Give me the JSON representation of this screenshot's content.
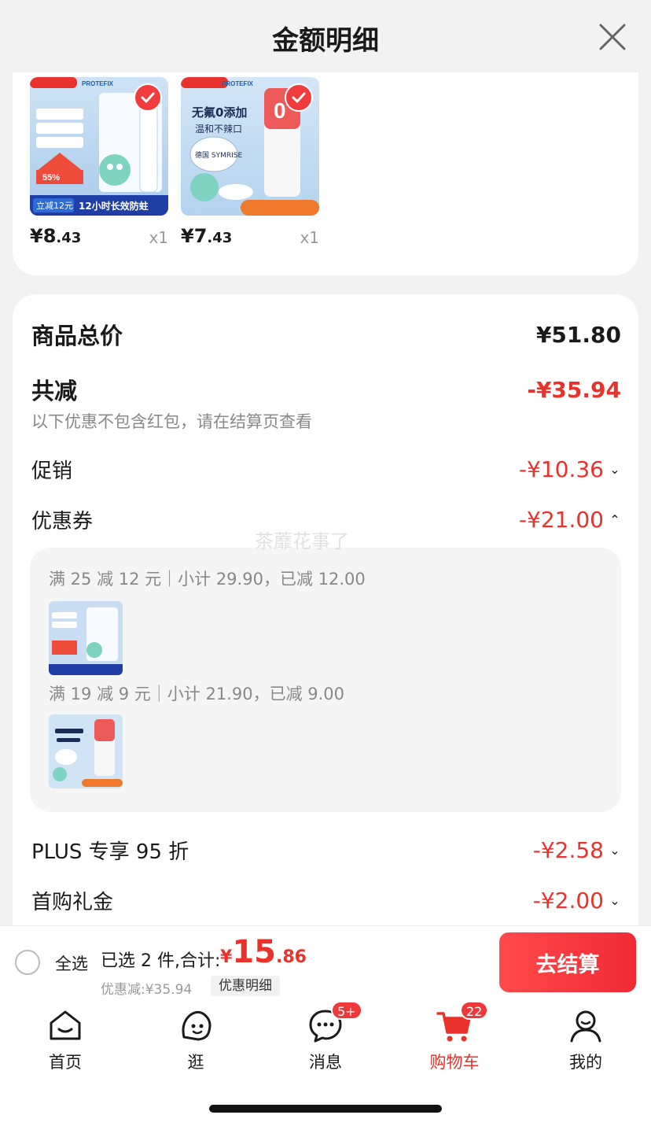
{
  "sheet": {
    "title": "金额明细"
  },
  "products": [
    {
      "price_main": "¥8",
      "price_dec": ".43",
      "qty": "x1",
      "brand": "PROTEFIX",
      "banner": "12小时长效防蛀",
      "tag": "立减12元",
      "badge": "55%"
    },
    {
      "price_main": "¥7",
      "price_dec": ".43",
      "qty": "x1",
      "brand": "PROTEFIX",
      "banner": "无氟0添加",
      "sub": "温和不辣口",
      "tag": "德国 SYMRISE"
    }
  ],
  "summary": {
    "total_label": "商品总价",
    "total_value": "¥51.80",
    "reduce_label": "共减",
    "reduce_value": "-¥35.94",
    "reduce_hint": "以下优惠不包含红包，请在结算页查看",
    "promo_label": "促销",
    "promo_value": "-¥10.36",
    "coupon_label": "优惠券",
    "coupon_value": "-¥21.00",
    "plus_label": "PLUS 专享 95 折",
    "plus_value": "-¥2.58",
    "first_label": "首购礼金",
    "first_value": "-¥2.00"
  },
  "coupons": [
    {
      "text": "满 25 减 12 元｜小计 29.90，已减 12.00"
    },
    {
      "text": "满 19 减 9 元｜小计 21.90，已减 9.00"
    }
  ],
  "watermark": "茶蘼花事了",
  "checkout": {
    "select_all": "全选",
    "selected": "已选 2 件,合计:",
    "currency": "¥",
    "total_int": "15",
    "total_dec": ".86",
    "discount": "优惠减:¥35.94",
    "detail_chip": "优惠明细",
    "button": "去结算"
  },
  "tabs": [
    {
      "label": "首页",
      "icon": "home-icon"
    },
    {
      "label": "逛",
      "icon": "explore-icon"
    },
    {
      "label": "消息",
      "icon": "message-icon",
      "badge": "5+"
    },
    {
      "label": "购物车",
      "icon": "cart-icon",
      "badge": "22"
    },
    {
      "label": "我的",
      "icon": "profile-icon"
    }
  ],
  "colors": {
    "accent": "#e8322b",
    "background": "#f2f2f2"
  }
}
